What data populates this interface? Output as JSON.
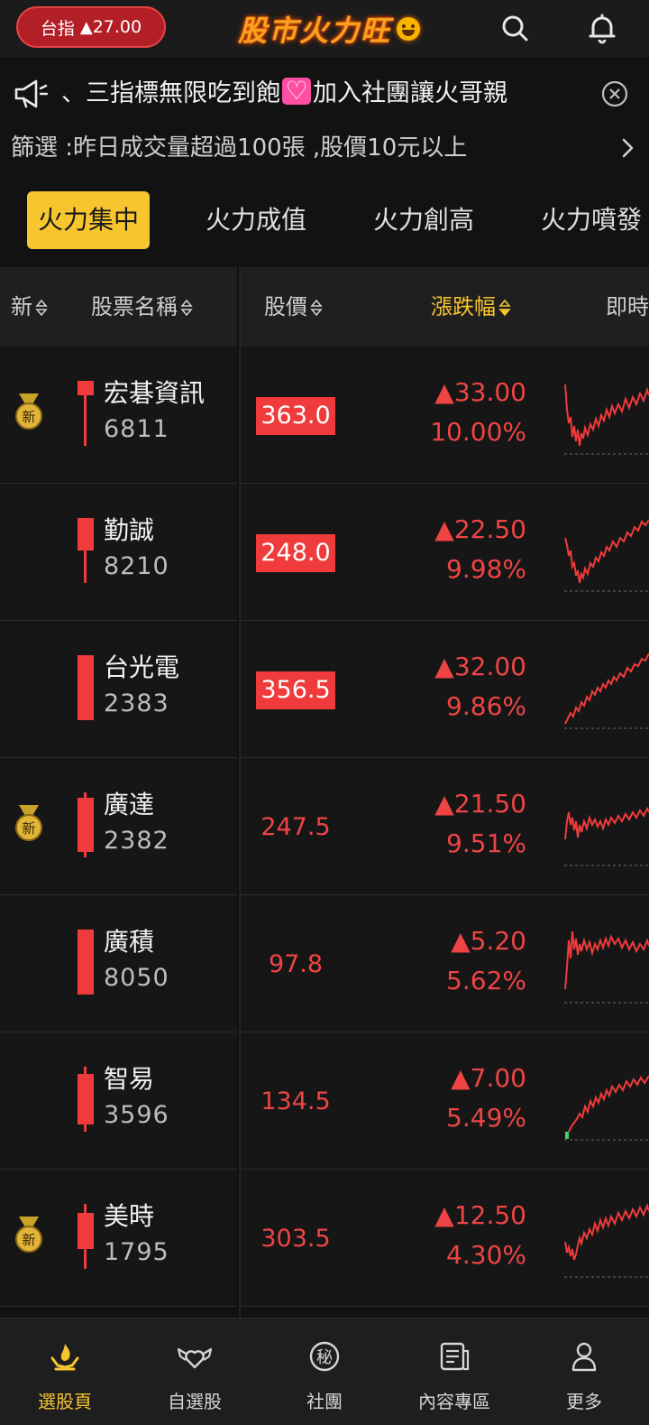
{
  "topbar": {
    "index_label": "台指",
    "index_change": "27.00",
    "app_title": "股市火力旺"
  },
  "announcement": {
    "text": "、三指標無限吃到飽",
    "text_after": "加入社團讓火哥親"
  },
  "filter": {
    "text": "篩選 :昨日成交量超過100張 ,股價10元以上"
  },
  "tabs": [
    {
      "label": "火力集中",
      "active": true
    },
    {
      "label": "火力成值",
      "active": false
    },
    {
      "label": "火力創高",
      "active": false
    },
    {
      "label": "火力噴發",
      "active": false
    }
  ],
  "table_header": {
    "new": "新",
    "name": "股票名稱",
    "price": "股價",
    "change": "漲跌幅",
    "realtime": "即時"
  },
  "stocks": [
    {
      "is_new": true,
      "name": "宏碁資訊",
      "code": "6811",
      "price": "363.0",
      "limit_up": true,
      "change": "▲33.00",
      "pct": "10.00%"
    },
    {
      "is_new": false,
      "name": "勤誠",
      "code": "8210",
      "price": "248.0",
      "limit_up": true,
      "change": "▲22.50",
      "pct": "9.98%"
    },
    {
      "is_new": false,
      "name": "台光電",
      "code": "2383",
      "price": "356.5",
      "limit_up": true,
      "change": "▲32.00",
      "pct": "9.86%"
    },
    {
      "is_new": true,
      "name": "廣達",
      "code": "2382",
      "price": "247.5",
      "limit_up": false,
      "change": "▲21.50",
      "pct": "9.51%"
    },
    {
      "is_new": false,
      "name": "廣積",
      "code": "8050",
      "price": "97.8",
      "limit_up": false,
      "change": "▲5.20",
      "pct": "5.62%"
    },
    {
      "is_new": false,
      "name": "智易",
      "code": "3596",
      "price": "134.5",
      "limit_up": false,
      "change": "▲7.00",
      "pct": "5.49%"
    },
    {
      "is_new": true,
      "name": "美時",
      "code": "1795",
      "price": "303.5",
      "limit_up": false,
      "change": "▲12.50",
      "pct": "4.30%"
    }
  ],
  "badge_text": "新",
  "bottom_nav": [
    {
      "label": "選股頁",
      "active": true,
      "icon": "flame-hands-icon"
    },
    {
      "label": "自選股",
      "active": false,
      "icon": "winged-heart-icon"
    },
    {
      "label": "社團",
      "active": false,
      "icon": "secret-badge-icon",
      "glyph": "秘"
    },
    {
      "label": "內容專區",
      "active": false,
      "icon": "content-icon"
    },
    {
      "label": "更多",
      "active": false,
      "icon": "person-icon"
    }
  ],
  "colors": {
    "accent": "#f7c62f",
    "up": "#ef3b3b",
    "background": "#121212"
  }
}
